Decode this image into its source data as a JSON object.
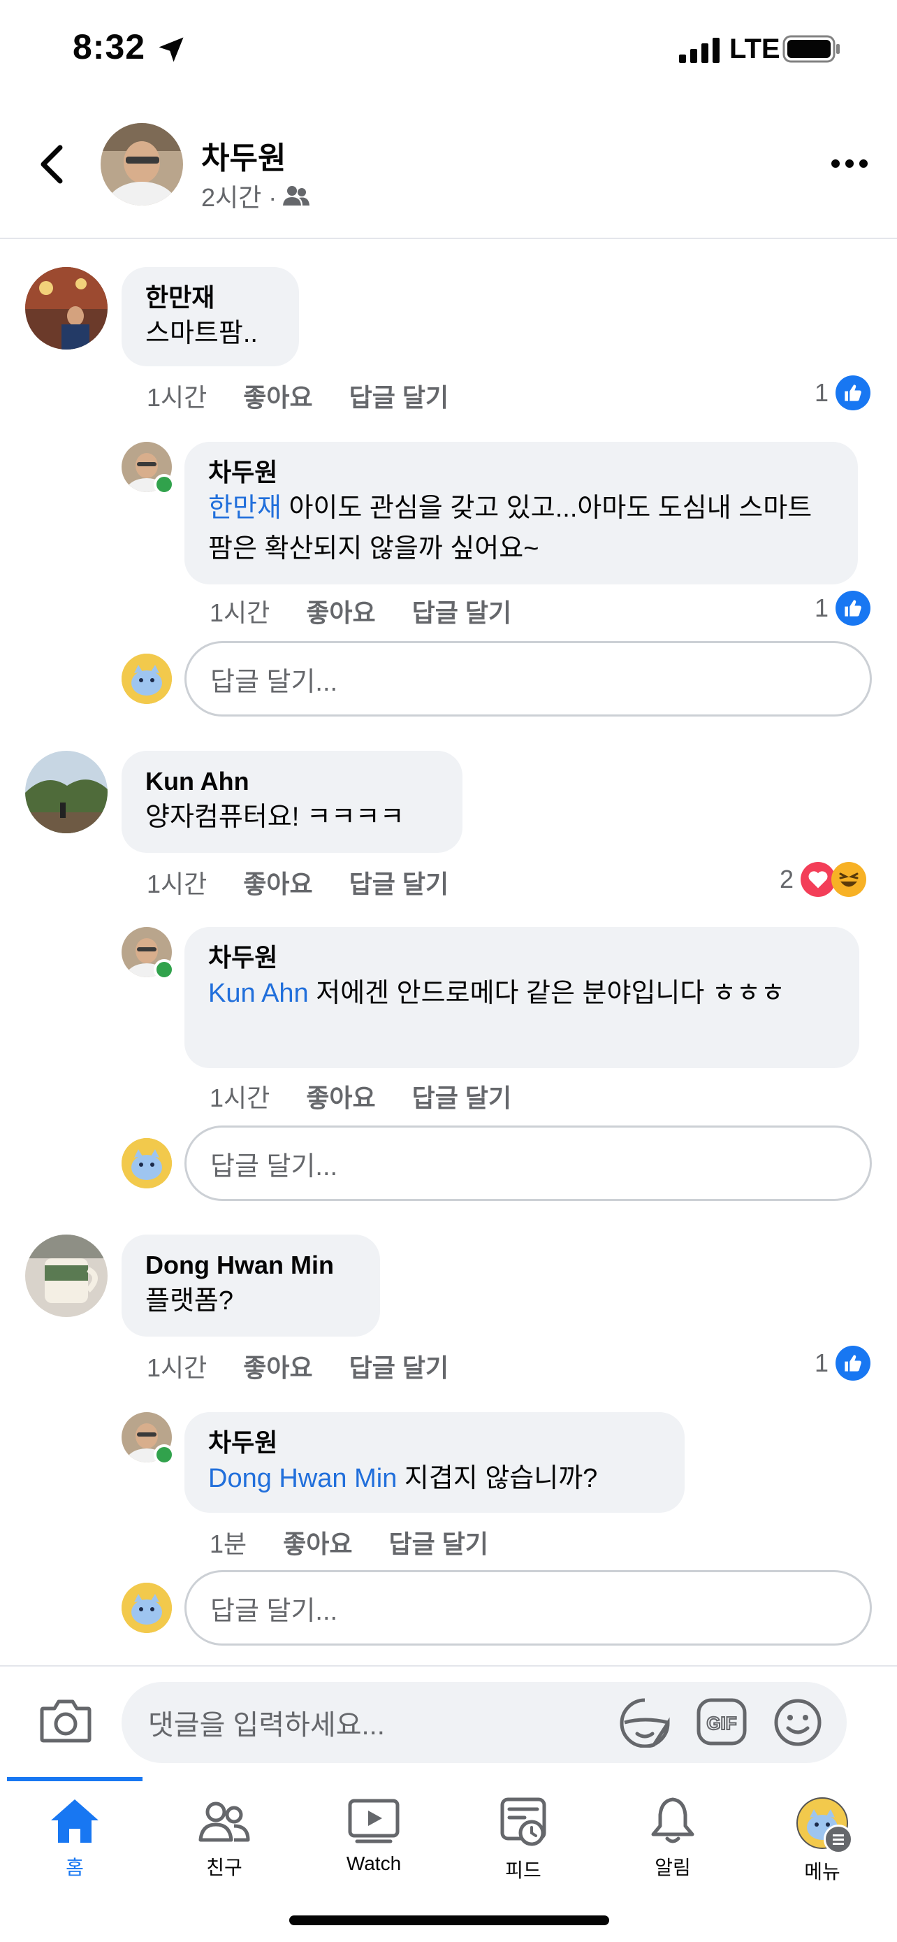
{
  "status_bar": {
    "time": "8:32",
    "network": "LTE"
  },
  "header": {
    "name": "차두원",
    "meta": "2시간 ·",
    "privacy_icon": "friends-icon"
  },
  "comments": [
    {
      "author": "한만재",
      "text": "스마트팜..",
      "time": "1시간",
      "like_label": "좋아요",
      "reply_label": "답글 달기",
      "reaction_count": "1",
      "reply": {
        "author": "차두원",
        "mention": "한만재",
        "text": " 아이도 관심을 갖고 있고...아마도 도심내 스마트팜은 확산되지 않을까 싶어요~",
        "time": "1시간",
        "like_label": "좋아요",
        "reply_label": "답글 달기",
        "reaction_count": "1"
      },
      "reply_placeholder": "답글 달기..."
    },
    {
      "author": "Kun Ahn",
      "text": "양자컴퓨터요! ㅋㅋㅋㅋ",
      "time": "1시간",
      "like_label": "좋아요",
      "reply_label": "답글 달기",
      "reaction_count": "2",
      "reply": {
        "author": "차두원",
        "mention": "Kun Ahn",
        "text": " 저에겐 안드로메다 같은 분야입니다 ㅎㅎㅎ",
        "time": "1시간",
        "like_label": "좋아요",
        "reply_label": "답글 달기"
      },
      "reply_placeholder": "답글 달기..."
    },
    {
      "author": "Dong Hwan Min",
      "text": "플랫폼?",
      "time": "1시간",
      "like_label": "좋아요",
      "reply_label": "답글 달기",
      "reaction_count": "1",
      "reply": {
        "author": "차두원",
        "mention": "Dong Hwan Min",
        "text": " 지겹지 않습니까?",
        "time": "1분",
        "like_label": "좋아요",
        "reply_label": "답글 달기"
      },
      "reply_placeholder": "답글 달기..."
    }
  ],
  "composer": {
    "placeholder": "댓글을 입력하세요..."
  },
  "tabs": [
    {
      "label": "홈",
      "icon": "home-icon",
      "active": true
    },
    {
      "label": "친구",
      "icon": "friends-icon",
      "active": false
    },
    {
      "label": "Watch",
      "icon": "watch-icon",
      "active": false
    },
    {
      "label": "피드",
      "icon": "feed-icon",
      "active": false
    },
    {
      "label": "알림",
      "icon": "bell-icon",
      "active": false
    },
    {
      "label": "메뉴",
      "icon": "menu-avatar-icon",
      "active": false
    }
  ],
  "colors": {
    "accent": "#1877f2",
    "mention": "#216fdb",
    "bubble": "#f0f2f5",
    "online": "#31a24c"
  }
}
